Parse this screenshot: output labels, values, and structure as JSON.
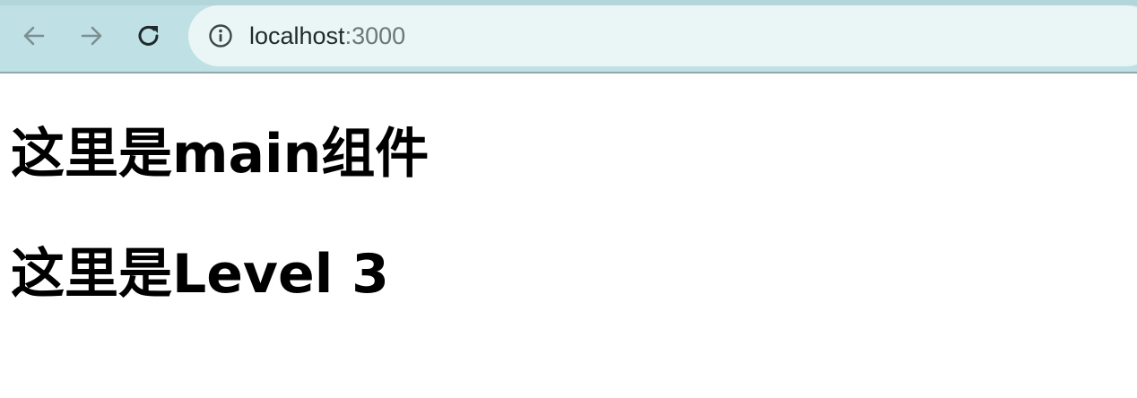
{
  "browser": {
    "address_bar": {
      "host": "localhost",
      "port": ":3000"
    },
    "icons": {
      "back": "back-arrow-icon",
      "forward": "forward-arrow-icon",
      "reload": "reload-icon",
      "site_info": "info-icon"
    },
    "colors": {
      "toolbar": "#bfe0e4",
      "omnibox": "#eaf5f6"
    }
  },
  "page": {
    "headings": [
      "这里是main组件",
      "这里是Level 3"
    ]
  }
}
